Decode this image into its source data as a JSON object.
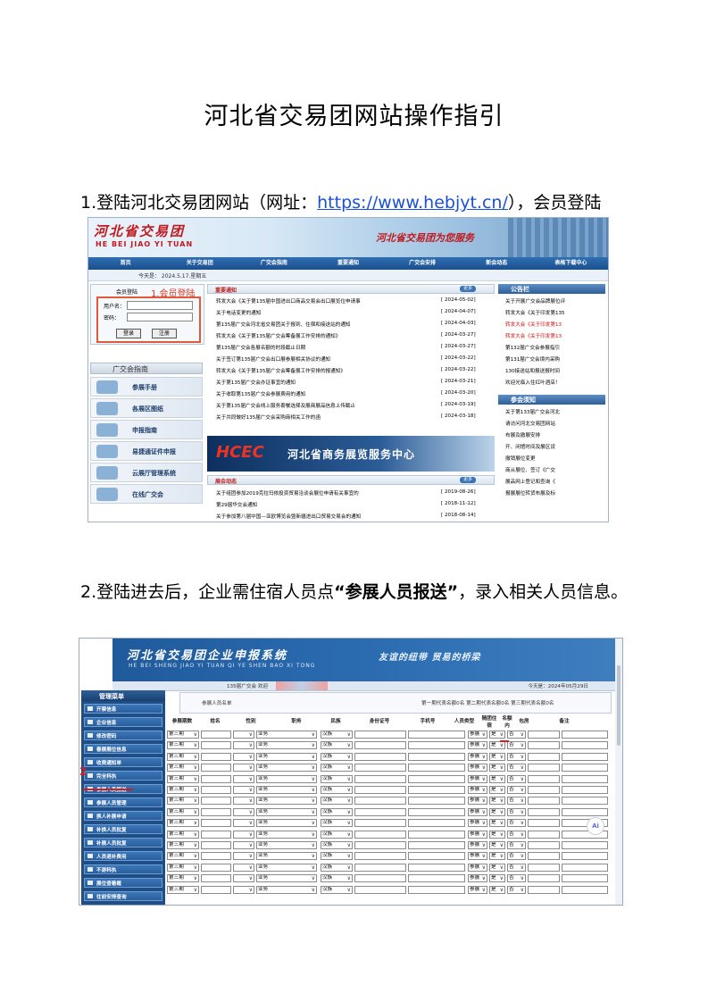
{
  "doc": {
    "title": "河北省交易团网站操作指引",
    "step1": {
      "prefix": "1.登陆河北交易团网站（网址：",
      "url": "https://www.hebjyt.cn/",
      "suffix": "），会员登陆"
    },
    "step2": {
      "prefix": "2.登陆进去后，企业需住宿人员点",
      "highlight": "“参展人员报送”",
      "suffix": "，录入相关人员信息。"
    }
  },
  "shot1": {
    "logo": "河北省交易团",
    "logo_en": "HE BEI JIAO YI TUAN",
    "slogan": "河北省交易团为您服务",
    "nav": [
      "首页",
      "关于交易团",
      "广交会指南",
      "重要通知",
      "广交会安排",
      "新会动态",
      "表格下载中心"
    ],
    "date": "今天是： 2024.5.17.星期五",
    "login": {
      "title": "会员登陆",
      "tag": "1.会员登陆",
      "user_label": "用户名：",
      "pass_label": "密码：",
      "login_btn": "登录",
      "register_btn": "注册"
    },
    "guide_title": "广交会指南",
    "guide_items": [
      "参展手册",
      "各展区图纸",
      "申报指南",
      "易捷通证件申报",
      "云展厅管理系统",
      "在线广交会"
    ],
    "notice_title": "重要通知",
    "more": "更多",
    "news": [
      {
        "t": "转发大会《关于第135届中国进出口商品交易会出口展览位申请事",
        "d": "[ 2024-05-02]"
      },
      {
        "t": "关于电话变更的通知",
        "d": "[ 2024-04-07]"
      },
      {
        "t": "第135届广交会河北省交易团关于报到、住宿和接送站的通知",
        "d": "[ 2024-04-03]"
      },
      {
        "t": "转发大会《关于第135届广交会筹备展工作安排的通知》",
        "d": "[ 2024-03-27]"
      },
      {
        "t": "第135届广交会各展名额的时段截止日期",
        "d": "[ 2024-03-27]"
      },
      {
        "t": "关于签订第135届广交会出口展参展相关协议的通知",
        "d": "[ 2024-03-22]"
      },
      {
        "t": "转发大会《关于第135届广交会筹备展工作安排的报通知》",
        "d": "[ 2024-03-22]"
      },
      {
        "t": "关于第135届广交会办证事宜的通知",
        "d": "[ 2024-03-21]"
      },
      {
        "t": "关于收取第135届广交会参展费用的通知",
        "d": "[ 2024-03-20]"
      },
      {
        "t": "关于第135届广交会线上服务套餐选择及展商展品信息上传截止",
        "d": "[ 2024-03-19]"
      },
      {
        "t": "关于共同做好135届广交会采购商相关工作的函",
        "d": "[ 2024-03-18]"
      }
    ],
    "banner2": "河北省商务展览服务中心",
    "banner2_logo": "HCEC",
    "trends_title": "展会动态",
    "trends": [
      {
        "t": "关于组团参加2019克拉玛依投资贸易洽谈会展位申请有关事宜的",
        "d": "[ 2019-08-26]"
      },
      {
        "t": "第29届华交会通知",
        "d": "[ 2018-11-12]"
      },
      {
        "t": "关于参加第八届中国—亚欧博览会暨新疆进出口贸易交易会的通知",
        "d": "[ 2018-08-14]"
      }
    ],
    "board_title": "公告栏",
    "board": [
      {
        "t": "关于开展广交会品牌展位评",
        "red": false
      },
      {
        "t": "转发大会《关于印发第135",
        "red": false
      },
      {
        "t": "转发大会《关于印发第13",
        "red": true
      },
      {
        "t": "转发大会《关于印发第13",
        "red": true
      },
      {
        "t": "第132届广交会参展指引",
        "red": false
      },
      {
        "t": "第131届广交会境内采购",
        "red": false
      },
      {
        "t": "130接送站和报送报时间",
        "red": false
      },
      {
        "t": "欢迎光临入住红叶酒店！",
        "red": false
      }
    ],
    "must_title": "参会须知",
    "must": [
      "关于第133届广交会河北",
      "请访问河北交易团网站",
      "布展及撤展安排",
      "开、闭馆时间及展区设",
      "撤销展位变更",
      "商从展位、签订《广交",
      "展品网上登记和查询《",
      "报展展位转货布展及标"
    ]
  },
  "shot2": {
    "title": "河北省交易团企业申报系统",
    "title_en": "HE BEI SHENG JIAO YI TUAN QI YE SHEN BAO XI TONG",
    "slogan": "友谊的纽带  贸易的桥梁",
    "infobar_left": "135届广交会  欢迎",
    "infobar_right": "今天是：2024年05月29日",
    "menu_title": "管理菜单",
    "menu_items": [
      "开票信息",
      "企业信息",
      "修改密码",
      "春展展位信息",
      "收费通知单",
      "完全科执",
      "参展人员报送",
      "参展人员管理",
      "换人补展申请",
      "补换人员批复",
      "补展人员批复",
      "人员退补费用",
      "不游科执",
      "展位查看概",
      "往前安排查询"
    ],
    "step_num": "2",
    "list_title": "参展人员名单",
    "quota": "第一期代表名额0名  第二期代表名额0名  第三期代表名额0名",
    "headers": [
      "参展期数",
      "姓名",
      "性别",
      "职务",
      "民族",
      "身份证号",
      "手机号",
      "人员类型",
      "随团住宿",
      "名额内",
      "包房",
      "备注"
    ],
    "rows": [
      [
        "第三期",
        "",
        "",
        "业务",
        "汉族",
        "",
        "",
        "参展",
        "是",
        "否"
      ],
      [
        "第三期",
        "",
        "",
        "业务",
        "汉族",
        "",
        "",
        "参展",
        "是",
        "否"
      ],
      [
        "第三期",
        "",
        "",
        "业务",
        "汉族",
        "",
        "",
        "参展",
        "是",
        "否"
      ],
      [
        "第三期",
        "",
        "",
        "业务",
        "汉族",
        "",
        "",
        "参展",
        "是",
        "否"
      ],
      [
        "第三期",
        "",
        "",
        "业务",
        "汉族",
        "",
        "",
        "参展",
        "是",
        "否"
      ],
      [
        "第三期",
        "",
        "",
        "业务",
        "汉族",
        "",
        "",
        "参展",
        "是",
        "否"
      ],
      [
        "第三期",
        "",
        "",
        "业务",
        "汉族",
        "",
        "",
        "参展",
        "是",
        "否"
      ],
      [
        "第三期",
        "",
        "",
        "业务",
        "汉族",
        "",
        "",
        "参展",
        "是",
        "否"
      ],
      [
        "第三期",
        "",
        "",
        "业务",
        "汉族",
        "",
        "",
        "参展",
        "是",
        "否"
      ],
      [
        "第三期",
        "",
        "",
        "业务",
        "汉族",
        "",
        "",
        "参展",
        "是",
        "否"
      ],
      [
        "第三期",
        "",
        "",
        "业务",
        "汉族",
        "",
        "",
        "参展",
        "是",
        "否"
      ],
      [
        "第三期",
        "",
        "",
        "业务",
        "汉族",
        "",
        "",
        "参展",
        "是",
        "否"
      ],
      [
        "第三期",
        "",
        "",
        "业务",
        "汉族",
        "",
        "",
        "参展",
        "是",
        "否"
      ],
      [
        "第三期",
        "",
        "",
        "业务",
        "汉族",
        "",
        "",
        "参展",
        "是",
        "否"
      ],
      [
        "第三期",
        "",
        "",
        "业务",
        "汉族",
        "",
        "",
        "参展",
        "是",
        "否"
      ]
    ],
    "ai_badge": "Ai"
  }
}
